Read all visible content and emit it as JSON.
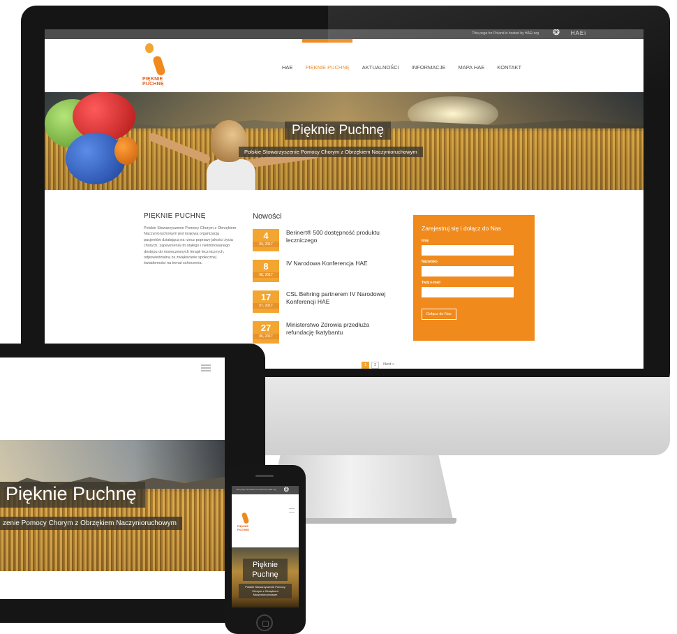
{
  "site": {
    "topbar_text": "This page for Poland is hosted by HAEi.org",
    "hae_logo": "HAEi",
    "logo_text": "PIĘKNIE PUCHNĘ",
    "colors": {
      "accent": "#f08a1c",
      "date": "#f2a531",
      "topbar": "#4d4d4d"
    }
  },
  "nav": {
    "items": [
      {
        "label": "HAE"
      },
      {
        "label": "PIĘKNIE PUCHNĘ"
      },
      {
        "label": "AKTUALNOŚCI"
      },
      {
        "label": "INFORMACJE"
      },
      {
        "label": "MAPA HAE"
      },
      {
        "label": "KONTAKT"
      }
    ],
    "active": "PIĘKNIE PUCHNĘ"
  },
  "hero": {
    "title": "Pięknie Puchnę",
    "subtitle": "Polskie Stowarzyszenie Pomocy Chorym z Obrzękiem Naczynioruchowym"
  },
  "about": {
    "heading": "PIĘKNIE PUCHNĘ",
    "body": "Polskie Stowarzyszenie Pomocy Chorym z Obrzękiem Naczynioruchowym jest krajową organizacją pacjentów działającą na rzecz poprawy jakości życia chorych, zapewnienia im stałego i nielimitowanego dostępu do nowoczesnych terapii lecznicznych, odpowiedzialną za zwiększanie społecznej świadomości na temat schorzenia."
  },
  "news": {
    "heading": "Nowości",
    "items": [
      {
        "day": "4",
        "month_year": "09, 2017",
        "title": "Berinert® 500 dostępność produktu leczniczego"
      },
      {
        "day": "8",
        "month_year": "08, 2017",
        "title": "IV Narodowa Konferencja HAE"
      },
      {
        "day": "17",
        "month_year": "07, 2017",
        "title": "CSL Behring partnerem IV Narodowej Konferencji HAE"
      },
      {
        "day": "27",
        "month_year": "06, 2017",
        "title": "Ministerstwo Zdrowia przedłuża refundację Ikatybantu"
      }
    ],
    "pager": {
      "pages": [
        "1",
        "2"
      ],
      "current": "1",
      "next": "Next »"
    }
  },
  "form": {
    "heading": "Zarejestruj się i dołącz do Nas",
    "fields": [
      {
        "label": "Imię",
        "value": ""
      },
      {
        "label": "Nazwisko",
        "value": ""
      },
      {
        "label": "Twój e-mail",
        "value": ""
      }
    ],
    "submit": "Dołącz do Nas"
  },
  "tablet": {
    "title": "Pięknie Puchnę",
    "subtitle": "zenie Pomocy Chorym z Obrzękiem Naczynioruchowym"
  },
  "phone": {
    "title": "Pięknie Puchnę",
    "subtitle": "Polskie Stowarzyszenie Pomocy Chorym z Obrzękiem Naczynioruchowym"
  }
}
